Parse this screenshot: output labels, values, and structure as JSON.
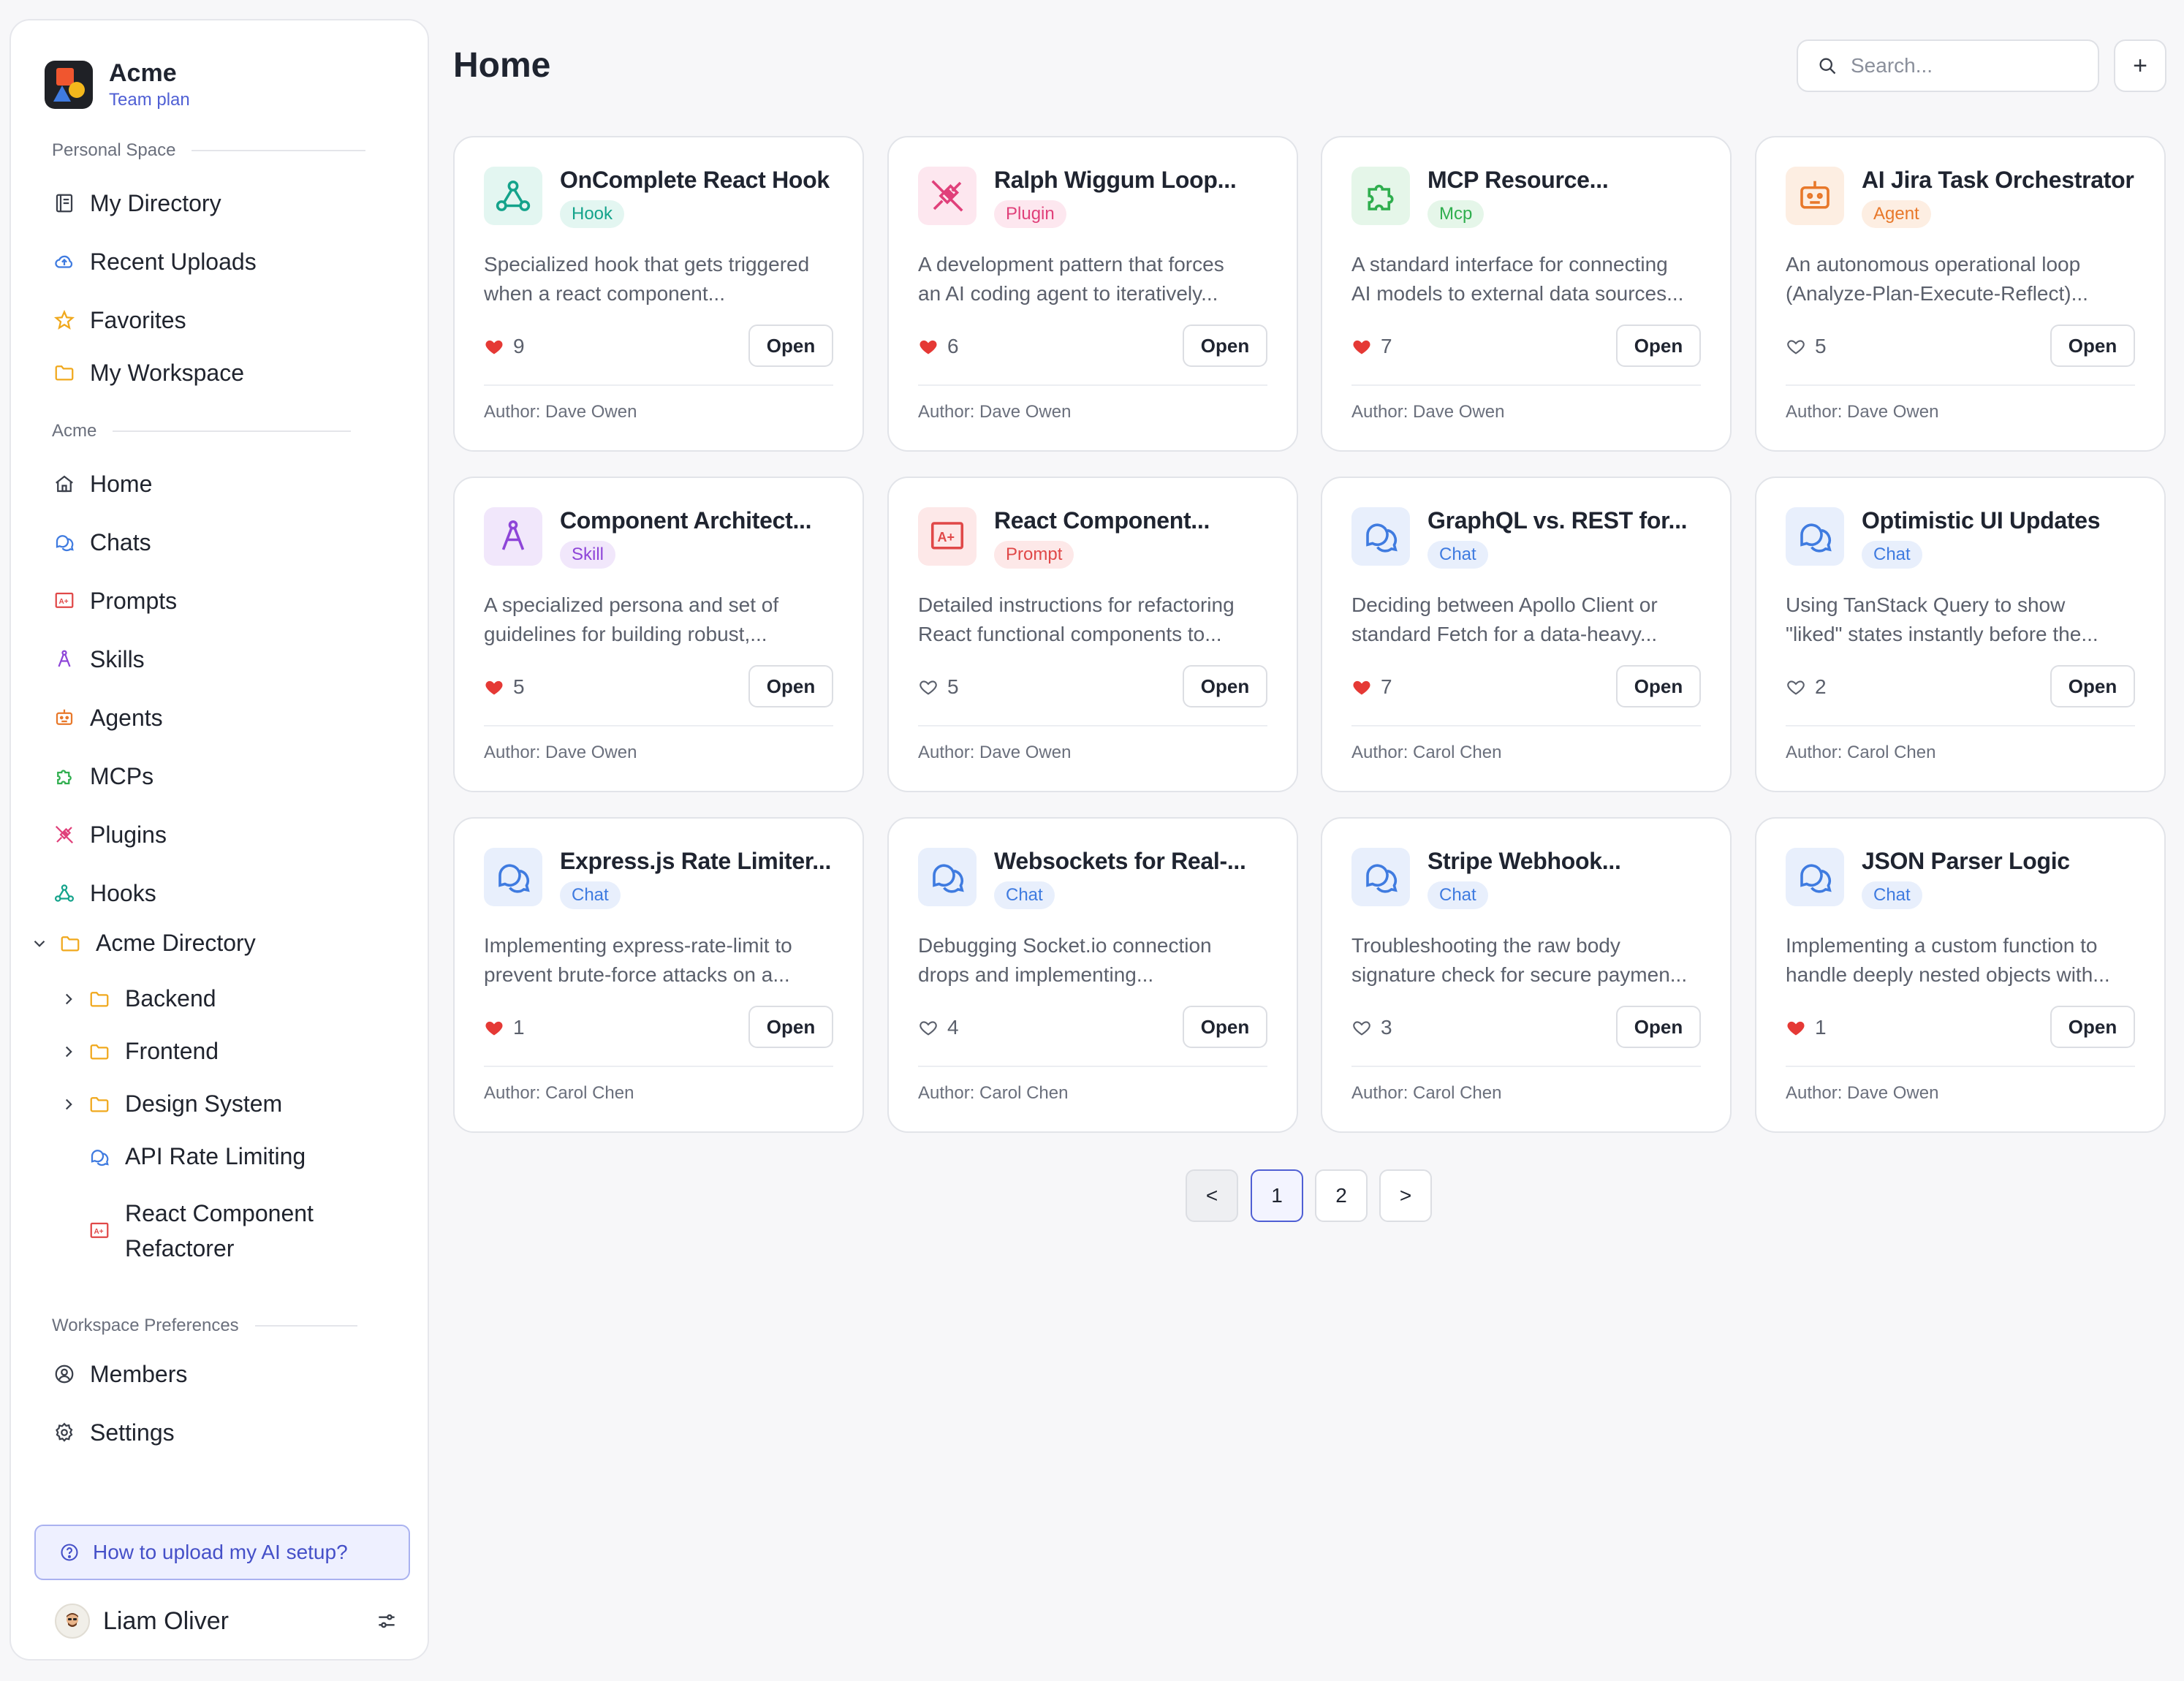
{
  "brand": {
    "name": "Acme",
    "plan": "Team plan"
  },
  "sections": {
    "personal": "Personal Space",
    "acme": "Acme",
    "prefs": "Workspace Preferences"
  },
  "personal_items": [
    {
      "label": "My Directory",
      "icon": "directory-icon"
    },
    {
      "label": "Recent Uploads",
      "icon": "cloud-upload-icon"
    },
    {
      "label": "Favorites",
      "icon": "star-icon"
    },
    {
      "label": "My Workspace",
      "icon": "folder-icon"
    }
  ],
  "acme_items": [
    {
      "label": "Home",
      "icon": "home-icon"
    },
    {
      "label": "Chats",
      "icon": "chat-icon"
    },
    {
      "label": "Prompts",
      "icon": "prompt-icon"
    },
    {
      "label": "Skills",
      "icon": "skill-icon"
    },
    {
      "label": "Agents",
      "icon": "agent-icon"
    },
    {
      "label": "MCPs",
      "icon": "puzzle-icon"
    },
    {
      "label": "Plugins",
      "icon": "plug-icon"
    },
    {
      "label": "Hooks",
      "icon": "hook-icon"
    }
  ],
  "directory": {
    "label": "Acme Directory",
    "children": [
      {
        "label": "Backend"
      },
      {
        "label": "Frontend"
      },
      {
        "label": "Design System"
      },
      {
        "label": "API Rate Limiting"
      },
      {
        "label_line1": "React Component",
        "label_line2": "Refactorer"
      }
    ]
  },
  "pref_items": [
    {
      "label": "Members",
      "icon": "members-icon"
    },
    {
      "label": "Settings",
      "icon": "gear-icon"
    }
  ],
  "help": {
    "label": "How to upload my AI setup?"
  },
  "user": {
    "name": "Liam Oliver"
  },
  "header": {
    "title": "Home",
    "search_placeholder": "Search...",
    "add_label": "+"
  },
  "cards": [
    {
      "title": "OnComplete React Hook",
      "tag": "Hook",
      "desc1": "Specialized hook that gets triggered",
      "desc2": "when a react component...",
      "likes": "9",
      "liked": true,
      "author": "Author: Dave Owen",
      "open": "Open",
      "type": "hook"
    },
    {
      "title": "Ralph Wiggum Loop...",
      "tag": "Plugin",
      "desc1": "A development pattern that forces",
      "desc2": "an AI coding agent to iteratively...",
      "likes": "6",
      "liked": true,
      "author": "Author: Dave Owen",
      "open": "Open",
      "type": "plugin"
    },
    {
      "title": "MCP Resource...",
      "tag": "Mcp",
      "desc1": "A standard interface for connecting",
      "desc2": "AI models to external data sources...",
      "likes": "7",
      "liked": true,
      "author": "Author: Dave Owen",
      "open": "Open",
      "type": "mcp"
    },
    {
      "title": "AI Jira Task Orchestrator",
      "tag": "Agent",
      "desc1": "An autonomous operational loop",
      "desc2": "(Analyze-Plan-Execute-Reflect)...",
      "likes": "5",
      "liked": false,
      "author": "Author: Dave Owen",
      "open": "Open",
      "type": "agent"
    },
    {
      "title": "Component Architect...",
      "tag": "Skill",
      "desc1": "A specialized persona and set of",
      "desc2": "guidelines for building robust,...",
      "likes": "5",
      "liked": true,
      "author": "Author: Dave Owen",
      "open": "Open",
      "type": "skill"
    },
    {
      "title": "React Component...",
      "tag": "Prompt",
      "desc1": "Detailed instructions for refactoring",
      "desc2": "React functional components to...",
      "likes": "5",
      "liked": false,
      "author": "Author: Dave Owen",
      "open": "Open",
      "type": "prompt"
    },
    {
      "title": "GraphQL vs. REST for...",
      "tag": "Chat",
      "desc1": "Deciding between Apollo Client or",
      "desc2": "standard Fetch for a data-heavy...",
      "likes": "7",
      "liked": true,
      "author": "Author: Carol Chen",
      "open": "Open",
      "type": "chat"
    },
    {
      "title": "Optimistic UI Updates",
      "tag": "Chat",
      "desc1": "Using TanStack Query to show",
      "desc2": "\"liked\" states instantly before the...",
      "likes": "2",
      "liked": false,
      "author": "Author: Carol Chen",
      "open": "Open",
      "type": "chat"
    },
    {
      "title": "Express.js Rate Limiter...",
      "tag": "Chat",
      "desc1": "Implementing express-rate-limit to",
      "desc2": "prevent brute-force attacks on a...",
      "likes": "1",
      "liked": true,
      "author": "Author: Carol Chen",
      "open": "Open",
      "type": "chat"
    },
    {
      "title": "Websockets for Real-...",
      "tag": "Chat",
      "desc1": "Debugging Socket.io connection",
      "desc2": "drops and implementing...",
      "likes": "4",
      "liked": false,
      "author": "Author: Carol Chen",
      "open": "Open",
      "type": "chat"
    },
    {
      "title": "Stripe Webhook...",
      "tag": "Chat",
      "desc1": "Troubleshooting the raw body",
      "desc2": "signature check for secure paymen...",
      "likes": "3",
      "liked": false,
      "author": "Author: Carol Chen",
      "open": "Open",
      "type": "chat"
    },
    {
      "title": "JSON Parser Logic",
      "tag": "Chat",
      "desc1": "Implementing a custom function to",
      "desc2": "handle deeply nested objects with...",
      "likes": "1",
      "liked": true,
      "author": "Author: Dave Owen",
      "open": "Open",
      "type": "chat"
    }
  ],
  "pagination": {
    "prev": "<",
    "pages": [
      "1",
      "2"
    ],
    "current": "1",
    "next": ">"
  },
  "colors": {
    "accent": "#4f5fd4",
    "heart": "#e53935",
    "hook": "#14a38b",
    "plugin": "#e0407a",
    "mcp": "#2fae4e",
    "agent": "#e8782a",
    "skill": "#8e45d8",
    "prompt": "#e04848",
    "chat": "#3f7be0"
  }
}
